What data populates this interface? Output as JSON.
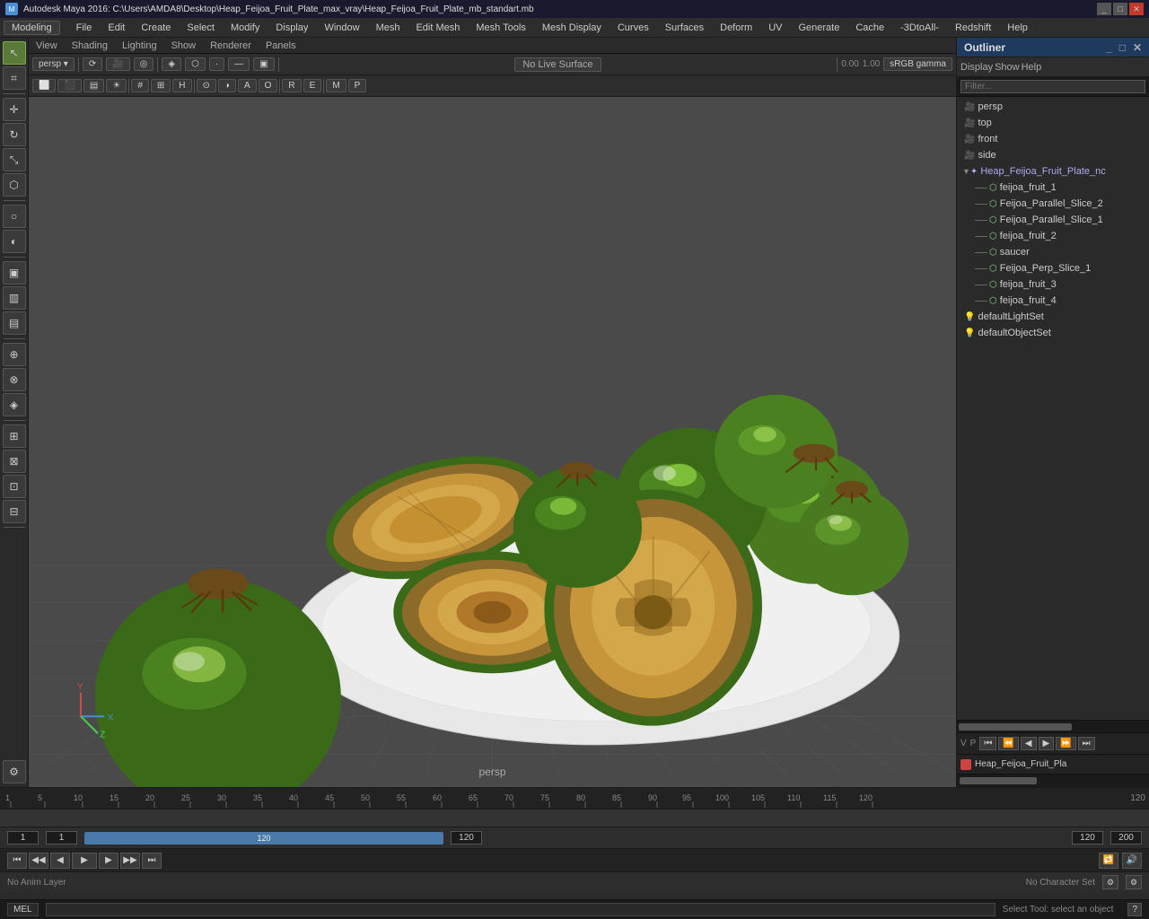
{
  "titlebar": {
    "title": "Autodesk Maya 2016: C:\\Users\\AMDA8\\Desktop\\Heap_Feijoa_Fruit_Plate_max_vray\\Heap_Feijoa_Fruit_Plate_mb_standart.mb",
    "icon": "M"
  },
  "menubar": {
    "items": [
      "File",
      "Edit",
      "Create",
      "Select",
      "Modify",
      "Display",
      "Window",
      "Mesh",
      "Edit Mesh",
      "Mesh Tools",
      "Mesh Display",
      "Curves",
      "Surfaces",
      "Deform",
      "UV",
      "Generate",
      "Cache",
      "-3DtoAll-",
      "Redshift",
      "Help"
    ]
  },
  "mode_selector": {
    "label": "Modeling"
  },
  "viewport": {
    "no_live_surface": "No Live Surface",
    "persp_label": "persp",
    "gamma_value": "0.00",
    "gamma_value2": "1.00",
    "color_space": "sRGB gamma"
  },
  "viewport_tabs": {
    "items": [
      "View",
      "Shading",
      "Lighting",
      "Show",
      "Renderer",
      "Panels"
    ]
  },
  "outliner": {
    "title": "Outliner",
    "menu_items": [
      "Display",
      "Show",
      "Help"
    ],
    "cameras": [
      {
        "name": "persp",
        "type": "camera"
      },
      {
        "name": "top",
        "type": "camera"
      },
      {
        "name": "front",
        "type": "camera"
      },
      {
        "name": "side",
        "type": "camera"
      }
    ],
    "scene_node": "Heap_Feijoa_Fruit_Plate_nc",
    "objects": [
      {
        "name": "feijoa_fruit_1",
        "type": "mesh"
      },
      {
        "name": "Feijoa_Parallel_Slice_2",
        "type": "mesh"
      },
      {
        "name": "Feijoa_Parallel_Slice_1",
        "type": "mesh"
      },
      {
        "name": "feijoa_fruit_2",
        "type": "mesh"
      },
      {
        "name": "saucer",
        "type": "mesh"
      },
      {
        "name": "Feijoa_Perp_Slice_1",
        "type": "mesh"
      },
      {
        "name": "feijoa_fruit_3",
        "type": "mesh"
      },
      {
        "name": "feijoa_fruit_4",
        "type": "mesh"
      }
    ],
    "sets": [
      {
        "name": "defaultLightSet",
        "type": "light"
      },
      {
        "name": "defaultObjectSet",
        "type": "set"
      }
    ],
    "object_display": "Heap_Feijoa_Fruit_Pla"
  },
  "timeline": {
    "start_frame": "1",
    "end_frame": "120",
    "range_start": "1",
    "range_end": "120",
    "playback_end": "200",
    "current_frame": "1",
    "ruler_marks": [
      "1",
      "5",
      "10",
      "15",
      "20",
      "25",
      "30",
      "35",
      "40",
      "45",
      "50",
      "55",
      "60",
      "65",
      "70",
      "75",
      "80",
      "85",
      "90",
      "95",
      "100",
      "105",
      "110",
      "115",
      "120"
    ]
  },
  "anim_layer": {
    "label": "No Anim Layer",
    "character_set_label": "No Character Set",
    "v_label": "V",
    "p_label": "P"
  },
  "status": {
    "mode": "MEL",
    "message": "Select Tool: select an object"
  },
  "tools": {
    "buttons": [
      "↖",
      "↔",
      "↻",
      "⬛",
      "⬛",
      "⬛",
      "⬛",
      "⬛",
      "⬛",
      "⬛",
      "⬛"
    ]
  }
}
